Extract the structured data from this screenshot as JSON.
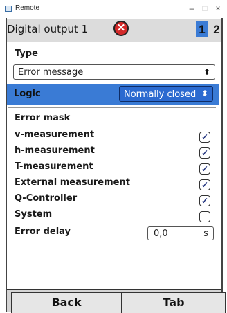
{
  "window": {
    "title": "Remote",
    "minimize_label": "–",
    "maximize_label": "□",
    "close_label": "×"
  },
  "header": {
    "title": "Digital output 1",
    "error_icon_glyph": "✕",
    "pages": [
      "1",
      "2"
    ],
    "active_page": "1",
    "accent_color": "#3a7bd5",
    "error_color": "#d32a2a"
  },
  "form": {
    "type_label": "Type",
    "type_value": "Error message",
    "select_arrow": "⬍",
    "logic_label": "Logic",
    "logic_value": "Normally closed",
    "error_mask_label": "Error mask",
    "mask_items": [
      {
        "label": "v-measurement",
        "checked": true
      },
      {
        "label": "h-measurement",
        "checked": true
      },
      {
        "label": "T-measurement",
        "checked": true
      },
      {
        "label": "External measurement",
        "checked": true
      },
      {
        "label": "Q-Controller",
        "checked": true
      },
      {
        "label": "System",
        "checked": false
      }
    ],
    "error_delay_label": "Error delay",
    "error_delay_value": "0,0",
    "error_delay_unit": "s"
  },
  "buttons": {
    "back_label": "Back",
    "tab_label": "Tab"
  }
}
